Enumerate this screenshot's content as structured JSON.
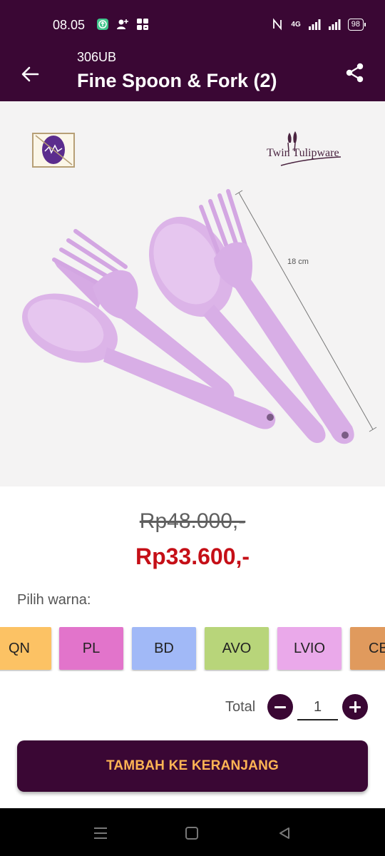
{
  "status_bar": {
    "time": "08.05",
    "network": "4G",
    "battery": "98"
  },
  "app_bar": {
    "code": "306UB",
    "title": "Fine Spoon & Fork (2)"
  },
  "product_image": {
    "brand": "Twin Tulipware",
    "measure": "18 cm"
  },
  "price": {
    "original": "Rp48.000,-",
    "sale": "Rp33.600,-"
  },
  "colors": {
    "label": "Pilih warna:",
    "options": [
      {
        "code": "QN",
        "hex": "#fcc264"
      },
      {
        "code": "PL",
        "hex": "#e274cb"
      },
      {
        "code": "BD",
        "hex": "#a1b9f7"
      },
      {
        "code": "AVO",
        "hex": "#b8d57a"
      },
      {
        "code": "LVIO",
        "hex": "#eaa9ea"
      },
      {
        "code": "CB",
        "hex": "#e09a5d"
      }
    ]
  },
  "quantity": {
    "label": "Total",
    "value": "1"
  },
  "cart_button": {
    "label": "TAMBAH KE KERANJANG"
  },
  "theme": {
    "primary": "#3a0734",
    "accent": "#ffb454",
    "sale_price": "#c50f17"
  }
}
